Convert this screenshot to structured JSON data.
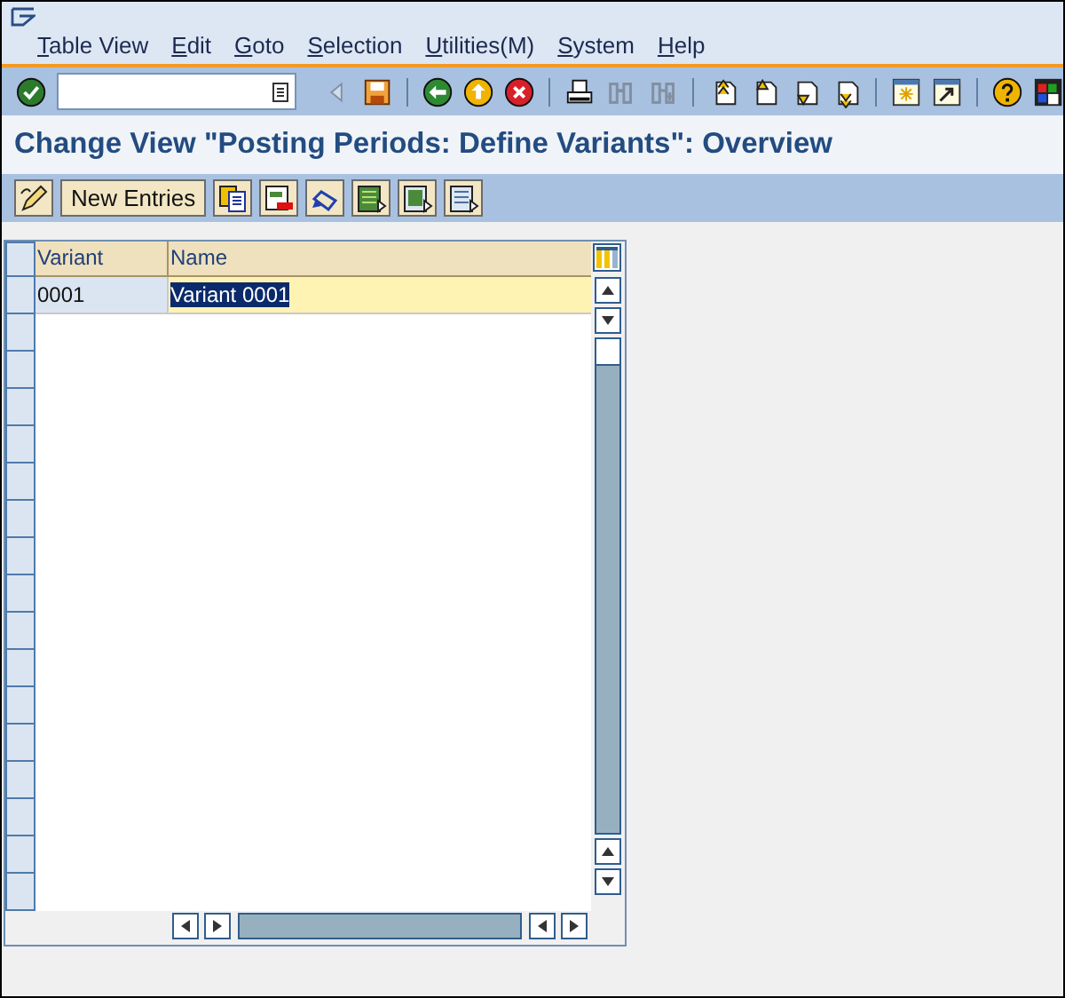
{
  "menu": [
    "Table View",
    "Edit",
    "Goto",
    "Selection",
    "Utilities(M)",
    "System",
    "Help"
  ],
  "toolbar": [
    {
      "kind": "enter",
      "disabled": false
    },
    {
      "kind": "command-field",
      "disabled": false
    },
    {
      "kind": "triangle",
      "disabled": true
    },
    {
      "kind": "save",
      "disabled": false
    },
    {
      "kind": "sep",
      "disabled": false
    },
    {
      "kind": "back",
      "disabled": false
    },
    {
      "kind": "exit",
      "disabled": false
    },
    {
      "kind": "cancel",
      "disabled": false
    },
    {
      "kind": "sep",
      "disabled": false
    },
    {
      "kind": "print",
      "disabled": false
    },
    {
      "kind": "find",
      "disabled": true
    },
    {
      "kind": "find-next",
      "disabled": true
    },
    {
      "kind": "sep",
      "disabled": false
    },
    {
      "kind": "first-page",
      "disabled": false
    },
    {
      "kind": "prev-page",
      "disabled": false
    },
    {
      "kind": "next-page",
      "disabled": false
    },
    {
      "kind": "last-page",
      "disabled": false
    },
    {
      "kind": "sep",
      "disabled": false
    },
    {
      "kind": "new-session",
      "disabled": false
    },
    {
      "kind": "shortcut",
      "disabled": false
    },
    {
      "kind": "sep",
      "disabled": false
    },
    {
      "kind": "help",
      "disabled": false
    },
    {
      "kind": "layout",
      "disabled": false
    }
  ],
  "title": "Change View \"Posting Periods: Define Variants\": Overview",
  "app_toolbar": [
    {
      "kind": "change-display"
    },
    {
      "kind": "text",
      "label": "New Entries"
    },
    {
      "kind": "copy"
    },
    {
      "kind": "delete"
    },
    {
      "kind": "undo"
    },
    {
      "kind": "select-all"
    },
    {
      "kind": "select-block"
    },
    {
      "kind": "deselect-all"
    }
  ],
  "table": {
    "columns": [
      "Variant",
      "Name"
    ],
    "rows": [
      {
        "cells": [
          "0001",
          "Variant 0001"
        ],
        "name_selected": true
      }
    ]
  }
}
